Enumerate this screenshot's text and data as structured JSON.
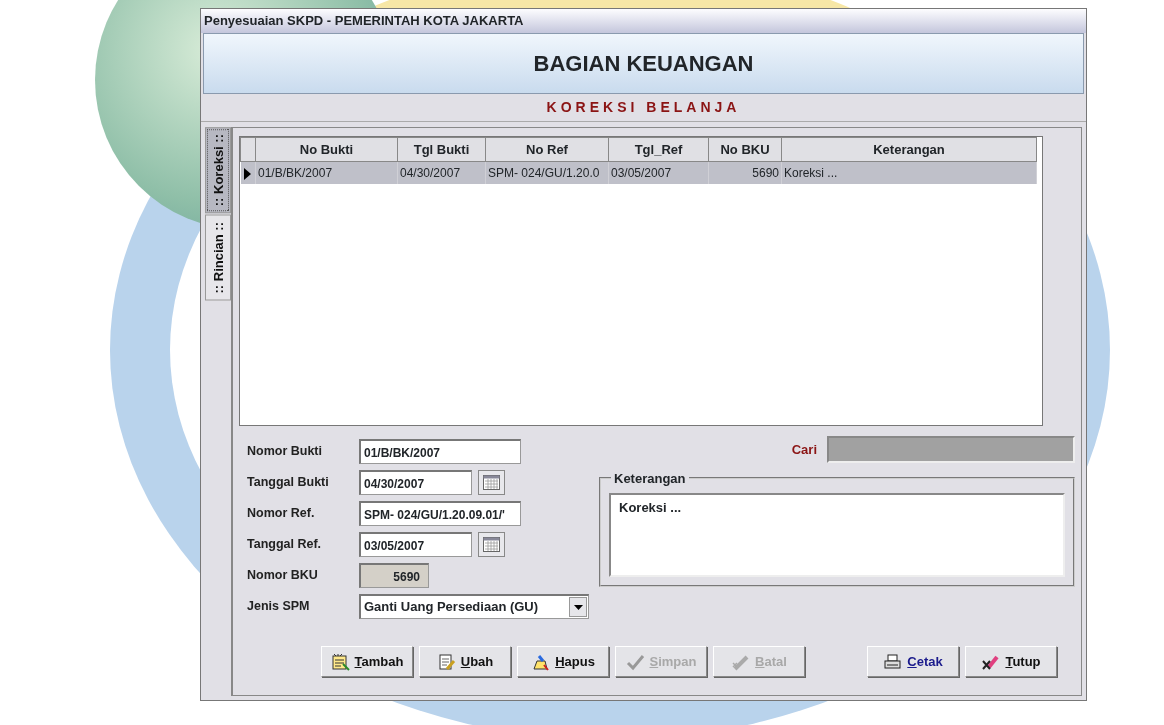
{
  "window": {
    "title": "Penyesuaian SKPD - PEMERINTAH KOTA JAKARTA"
  },
  "header": {
    "title": "BAGIAN KEUANGAN",
    "subtitle": "KOREKSI BELANJA"
  },
  "tabs": [
    {
      "label": ":: Koreksi ::",
      "selected": true
    },
    {
      "label": ":: Rincian ::",
      "selected": false
    }
  ],
  "table": {
    "columns": [
      "No Bukti",
      "Tgl Bukti",
      "No Ref",
      "Tgl_Ref",
      "No BKU",
      "Keterangan"
    ],
    "rows": [
      {
        "selected": true,
        "cells": [
          "01/B/BK/2007",
          "04/30/2007",
          "SPM- 024/GU/1.20.0",
          "03/05/2007",
          "5690",
          "Koreksi ..."
        ]
      }
    ]
  },
  "form": {
    "fields": [
      {
        "label": "Nomor Bukti",
        "value": "01/B/BK/2007",
        "kind": "text"
      },
      {
        "label": "Tanggal Bukti",
        "value": "04/30/2007",
        "kind": "date"
      },
      {
        "label": "Nomor Ref.",
        "value": "SPM- 024/GU/1.20.09.01/'",
        "kind": "text"
      },
      {
        "label": "Tanggal Ref.",
        "value": "03/05/2007",
        "kind": "date"
      },
      {
        "label": "Nomor BKU",
        "value": "5690",
        "kind": "readonly"
      },
      {
        "label": "Jenis SPM",
        "value": "Ganti Uang Persediaan (GU)",
        "kind": "select"
      }
    ]
  },
  "search": {
    "label": "Cari"
  },
  "notes": {
    "legend": "Keterangan",
    "value": "Koreksi ..."
  },
  "buttons": [
    {
      "label": "Tambah",
      "disabled": false,
      "emphasis": false
    },
    {
      "label": "Ubah",
      "disabled": false,
      "emphasis": false
    },
    {
      "label": "Hapus",
      "disabled": false,
      "emphasis": false
    },
    {
      "label": "Simpan",
      "disabled": true,
      "emphasis": false
    },
    {
      "label": "Batal",
      "disabled": true,
      "emphasis": false
    },
    {
      "label": "Cetak",
      "disabled": false,
      "emphasis": true
    },
    {
      "label": "Tutup",
      "disabled": false,
      "emphasis": false
    }
  ]
}
